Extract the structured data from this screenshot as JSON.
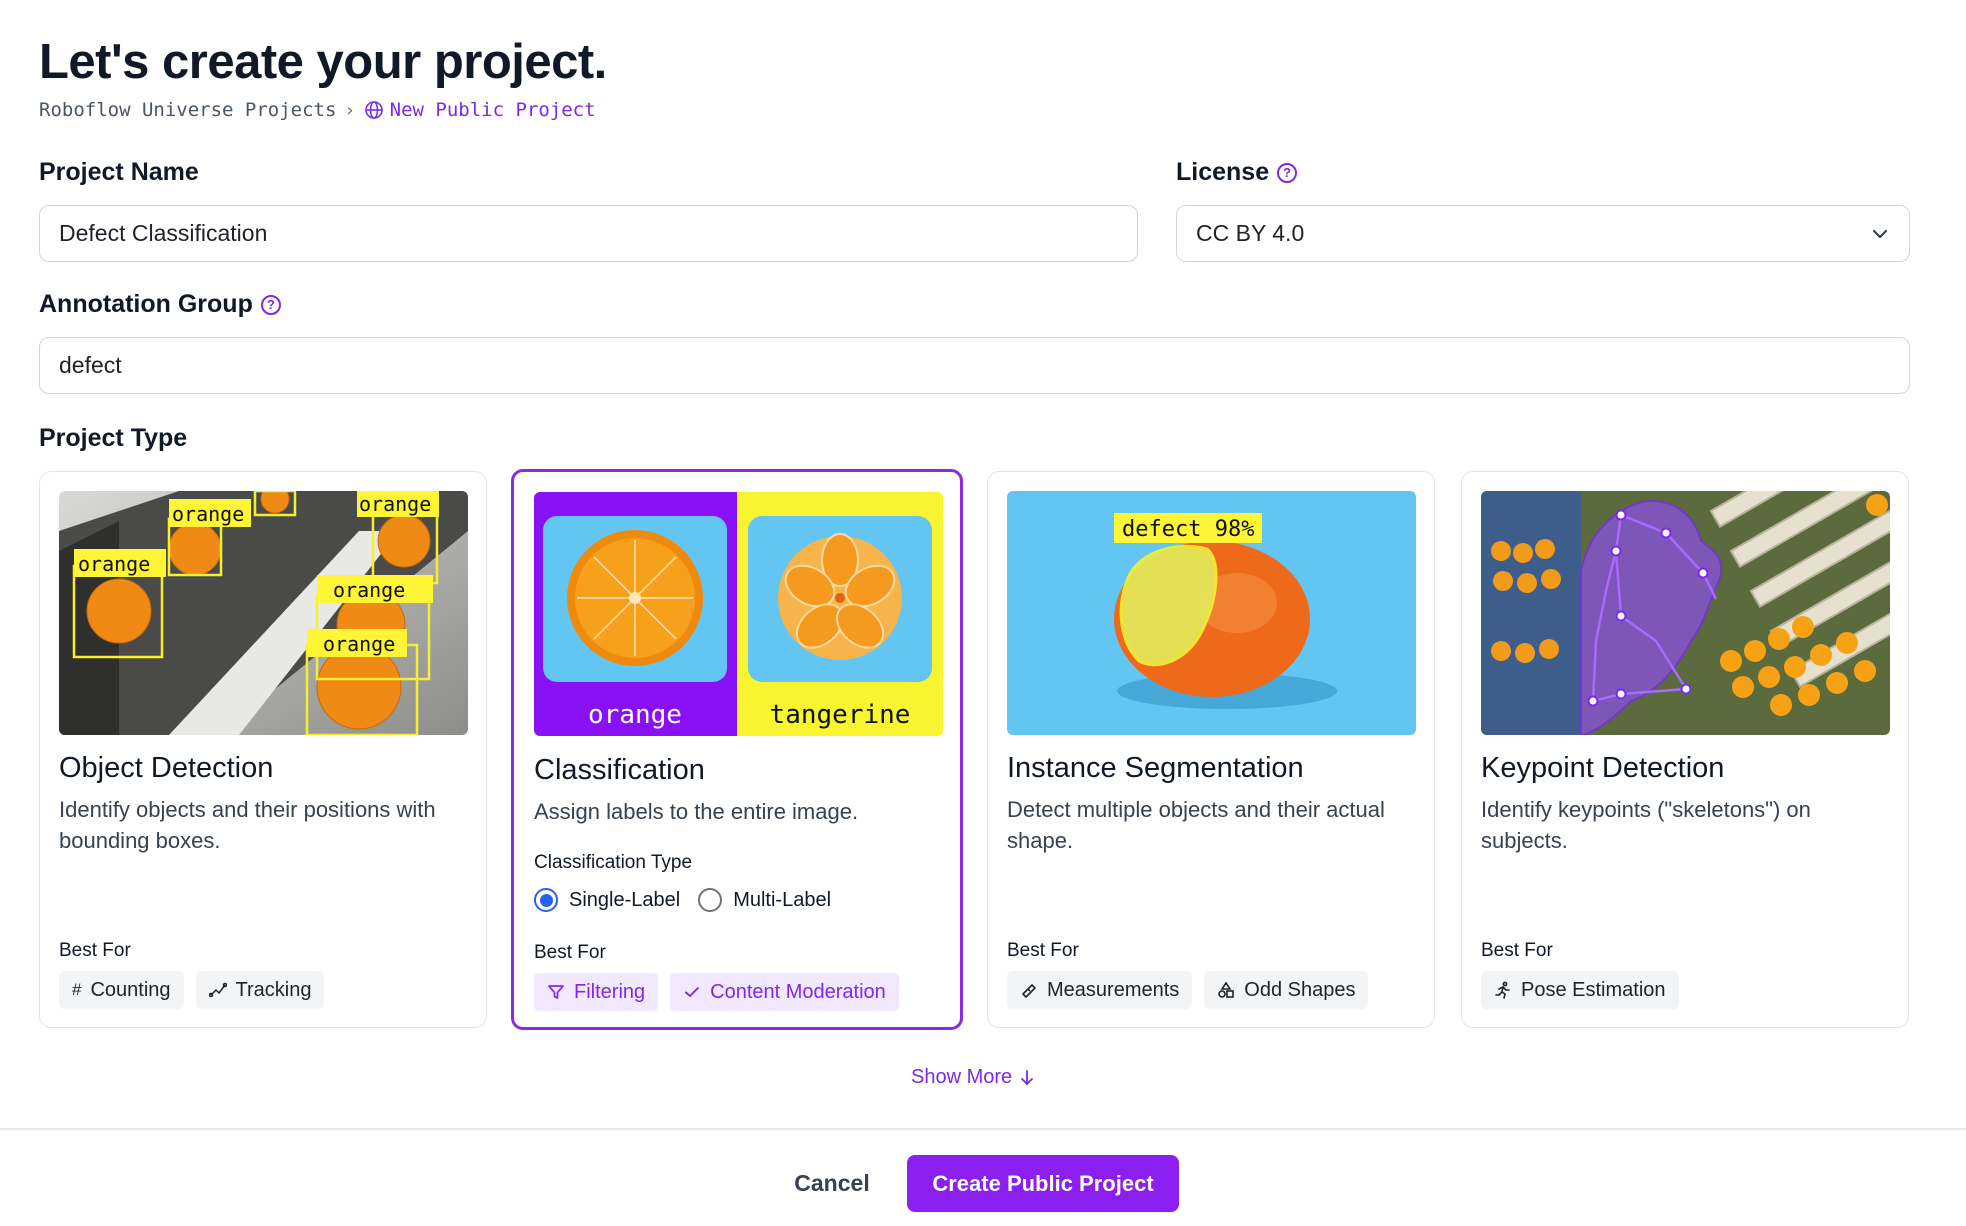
{
  "page": {
    "title": "Let's create your project."
  },
  "breadcrumb": {
    "root": "Roboflow Universe Projects",
    "current": "New Public Project"
  },
  "form": {
    "project_name": {
      "label": "Project Name",
      "value": "Defect Classification"
    },
    "license": {
      "label": "License",
      "value": "CC BY 4.0"
    },
    "annotation_group": {
      "label": "Annotation Group",
      "value": "defect"
    },
    "project_type_label": "Project Type"
  },
  "cards": [
    {
      "title": "Object Detection",
      "description": "Identify objects and their positions with bounding boxes.",
      "best_for_label": "Best For",
      "image_labels": [
        "orange",
        "orange",
        "orange",
        "orange",
        "orange"
      ],
      "chips": [
        {
          "label": "Counting",
          "icon": "hash-icon"
        },
        {
          "label": "Tracking",
          "icon": "tracking-icon"
        }
      ],
      "selected": false
    },
    {
      "title": "Classification",
      "description": "Assign labels to the entire image.",
      "best_for_label": "Best For",
      "image_labels": [
        "orange",
        "tangerine"
      ],
      "classification_type": {
        "label": "Classification Type",
        "options": [
          "Single-Label",
          "Multi-Label"
        ],
        "selected": "Single-Label"
      },
      "chips": [
        {
          "label": "Filtering",
          "icon": "filter-icon"
        },
        {
          "label": "Content Moderation",
          "icon": "check-icon"
        }
      ],
      "selected": true
    },
    {
      "title": "Instance Segmentation",
      "description": "Detect multiple objects and their actual shape.",
      "best_for_label": "Best For",
      "image_labels": [
        "defect 98%"
      ],
      "chips": [
        {
          "label": "Measurements",
          "icon": "ruler-icon"
        },
        {
          "label": "Odd Shapes",
          "icon": "shapes-icon"
        }
      ],
      "selected": false
    },
    {
      "title": "Keypoint Detection",
      "description": "Identify keypoints (\"skeletons\") on subjects.",
      "best_for_label": "Best For",
      "chips": [
        {
          "label": "Pose Estimation",
          "icon": "person-running-icon"
        }
      ],
      "selected": false
    }
  ],
  "show_more": "Show More",
  "footer": {
    "cancel": "Cancel",
    "create": "Create Public Project"
  },
  "colors": {
    "accent": "#8a1ff0",
    "accent_text": "#7c2ae8",
    "radio_selected": "#2563eb",
    "label_yellow": "#fdf535"
  }
}
